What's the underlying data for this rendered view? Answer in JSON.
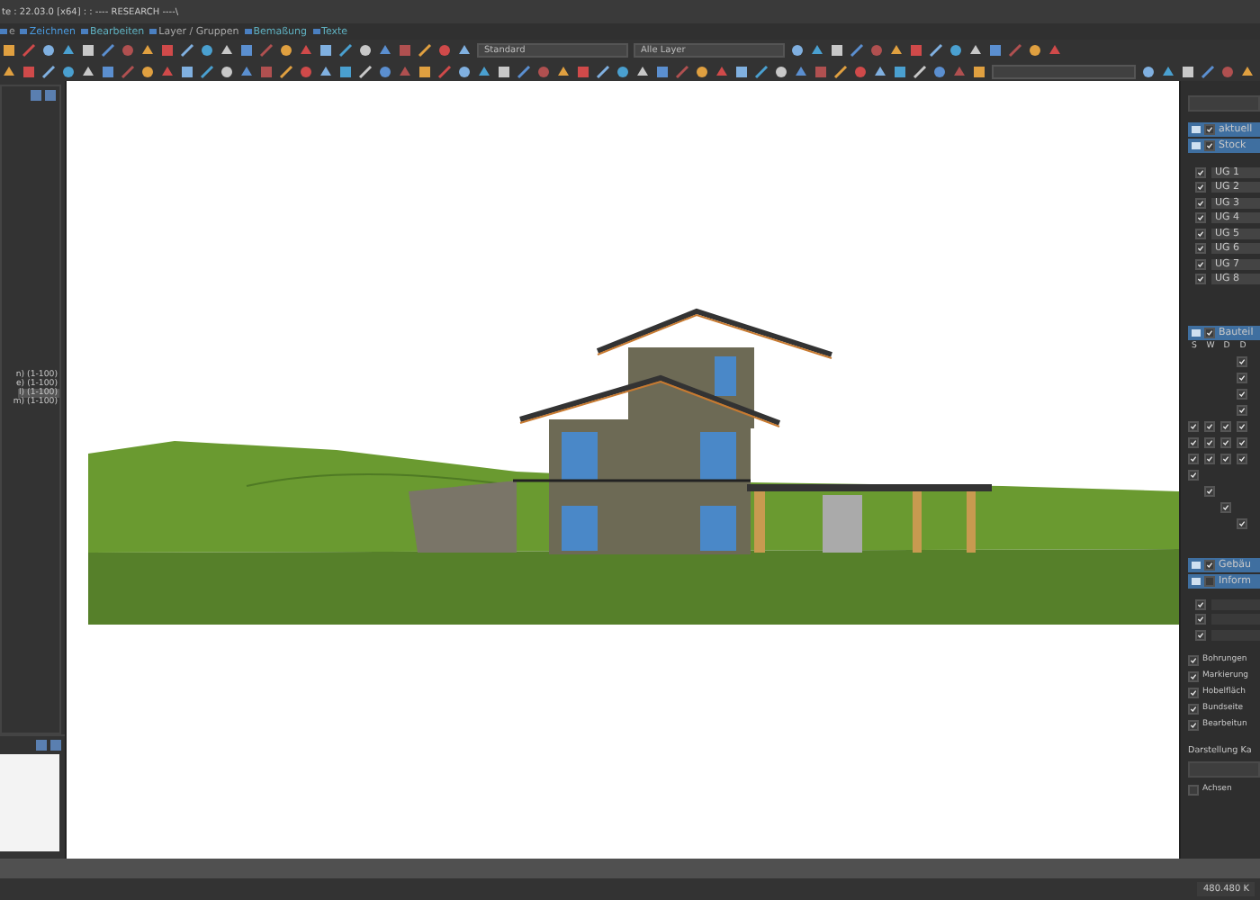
{
  "window": {
    "title": "te : 22.03.0 [x64] : : ---- RESEARCH ----\\"
  },
  "menu": [
    {
      "label": "e",
      "color": "#9a9a9a"
    },
    {
      "label": "Zeichnen",
      "color": "#4a9be0"
    },
    {
      "label": "Bearbeiten",
      "color": "#5fb0c0"
    },
    {
      "label": "Layer / Gruppen",
      "color": "#a8a8a8"
    },
    {
      "label": "Bemaßung",
      "color": "#5fb0c0"
    },
    {
      "label": "Texte",
      "color": "#5fb0c0"
    }
  ],
  "toolbar": {
    "style_select": {
      "value": "Standard"
    },
    "layer_select": {
      "value": "Alle Layer"
    }
  },
  "left_panel": {
    "items": [
      {
        "label": "n) (1-100)",
        "selected": false
      },
      {
        "label": "e) (1-100)",
        "selected": false
      },
      {
        "label": "l) (1-100)",
        "selected": true
      },
      {
        "label": "m) (1-100)",
        "selected": false
      }
    ]
  },
  "right_panel": {
    "layers": [
      {
        "label": "aktuell",
        "checked": true
      },
      {
        "label": "Stock",
        "checked": true
      }
    ],
    "floors": [
      {
        "label": "UG 1",
        "checked": true
      },
      {
        "label": "UG 2",
        "checked": true
      },
      {
        "label": "UG 3",
        "checked": true
      },
      {
        "label": "UG 4",
        "checked": true
      },
      {
        "label": "UG 5",
        "checked": true
      },
      {
        "label": "UG 6",
        "checked": true
      },
      {
        "label": "UG 7",
        "checked": true
      },
      {
        "label": "UG 8",
        "checked": true
      }
    ],
    "parts": {
      "label": "Bauteil",
      "checked": true,
      "columns": [
        "S",
        "W",
        "D",
        "D"
      ],
      "rows": [
        [
          false,
          false,
          false,
          true
        ],
        [
          false,
          false,
          false,
          true
        ],
        [
          false,
          false,
          false,
          true
        ],
        [
          false,
          false,
          false,
          true
        ],
        [
          true,
          true,
          true,
          true
        ],
        [
          true,
          true,
          true,
          true
        ],
        [
          true,
          true,
          true,
          true
        ],
        [
          true,
          false,
          false,
          false
        ],
        [
          false,
          true,
          false,
          false
        ],
        [
          false,
          false,
          true,
          false
        ],
        [
          false,
          false,
          false,
          true
        ]
      ]
    },
    "groups": [
      {
        "label": "Gebäu",
        "checked": true
      },
      {
        "label": "Inform",
        "checked": false
      }
    ],
    "info_rows": [
      {
        "checked": true
      },
      {
        "checked": true
      },
      {
        "checked": true
      }
    ],
    "options": [
      {
        "label": "Bohrungen",
        "checked": true
      },
      {
        "label": "Markierung",
        "checked": true
      },
      {
        "label": "Hobelfläch",
        "checked": true
      },
      {
        "label": "Bundseite",
        "checked": true
      },
      {
        "label": "Bearbeitun",
        "checked": true
      }
    ],
    "display": {
      "label": "Darstellung Ka",
      "axes": {
        "label": "Achsen",
        "checked": false
      }
    }
  },
  "status_bar": {
    "coordinates": "480.480 K"
  }
}
